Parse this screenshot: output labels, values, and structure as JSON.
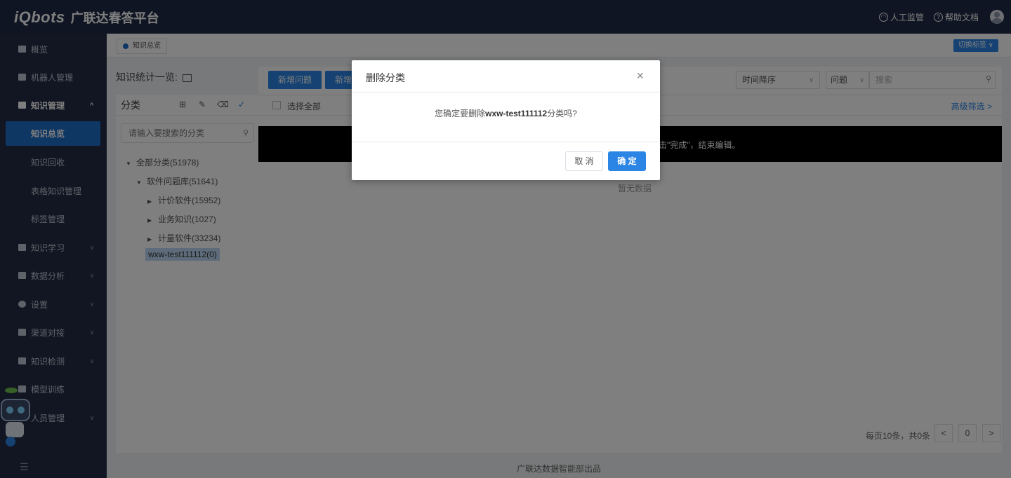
{
  "header": {
    "logo": "iQbots",
    "platform_name": "广联达春答平台",
    "links": [
      {
        "icon": "headset-icon",
        "label": "人工监管"
      },
      {
        "icon": "help-circle-icon",
        "label": "帮助文档"
      }
    ],
    "avatar_icon": "user-avatar-icon"
  },
  "sidebar": {
    "items": [
      {
        "label": "概览",
        "icon": "dashboard-icon"
      },
      {
        "label": "机器人管理",
        "icon": "robot-icon"
      },
      {
        "label": "知识管理",
        "icon": "book-icon",
        "expanded": true
      },
      {
        "label": "知识学习",
        "icon": "learning-icon"
      },
      {
        "label": "数据分析",
        "icon": "chart-icon"
      },
      {
        "label": "设置",
        "icon": "gear-icon"
      },
      {
        "label": "渠道对接",
        "icon": "channel-icon"
      },
      {
        "label": "知识检测",
        "icon": "check-icon"
      },
      {
        "label": "模型训练",
        "icon": "model-icon"
      },
      {
        "label": "人员管理",
        "icon": "people-icon"
      }
    ],
    "sub_items": [
      {
        "label": "知识总览",
        "active": true
      },
      {
        "label": "知识回收"
      },
      {
        "label": "表格知识管理"
      },
      {
        "label": "标签管理"
      }
    ],
    "collapse_icon": "menu-collapse-icon"
  },
  "tabs": {
    "active_tab": "知识总览",
    "switch_label": "切换标签 ∨"
  },
  "content": {
    "stats_title": "知识统计一览:",
    "category": {
      "title": "分类",
      "search_placeholder": "请输入要搜索的分类",
      "tree": [
        {
          "label": "全部分类(51978)",
          "level": 0,
          "expanded": true
        },
        {
          "label": "软件问题库(51641)",
          "level": 1,
          "expanded": true
        },
        {
          "label": "计价软件(15952)",
          "level": 2
        },
        {
          "label": "业务知识(1027)",
          "level": 2
        },
        {
          "label": "计量软件(33234)",
          "level": 2
        },
        {
          "label": "wxw-test111112(0)",
          "level": 1,
          "selected": true
        }
      ]
    },
    "toolbar": {
      "btn_new_question": "新增问题",
      "btn_new_2": "新增",
      "sort_label": "时间降序",
      "type_label": "问题",
      "search_placeholder": "搜索"
    },
    "select_all": "选择全部",
    "advanced_filter": "高级筛选 >",
    "banner_text": "击\"完成\"，结束编辑。",
    "empty_text": "暂无数据",
    "pagination": {
      "summary": "每页10条，共0条",
      "prev": "<",
      "page": "0",
      "next": ">"
    }
  },
  "footer": "广联达数据智能部出品",
  "modal": {
    "title": "删除分类",
    "message_prefix": "您确定要删除",
    "message_target": "wxw-test111112",
    "message_suffix": "分类吗?",
    "cancel_label": "取 消",
    "ok_label": "确 定"
  }
}
